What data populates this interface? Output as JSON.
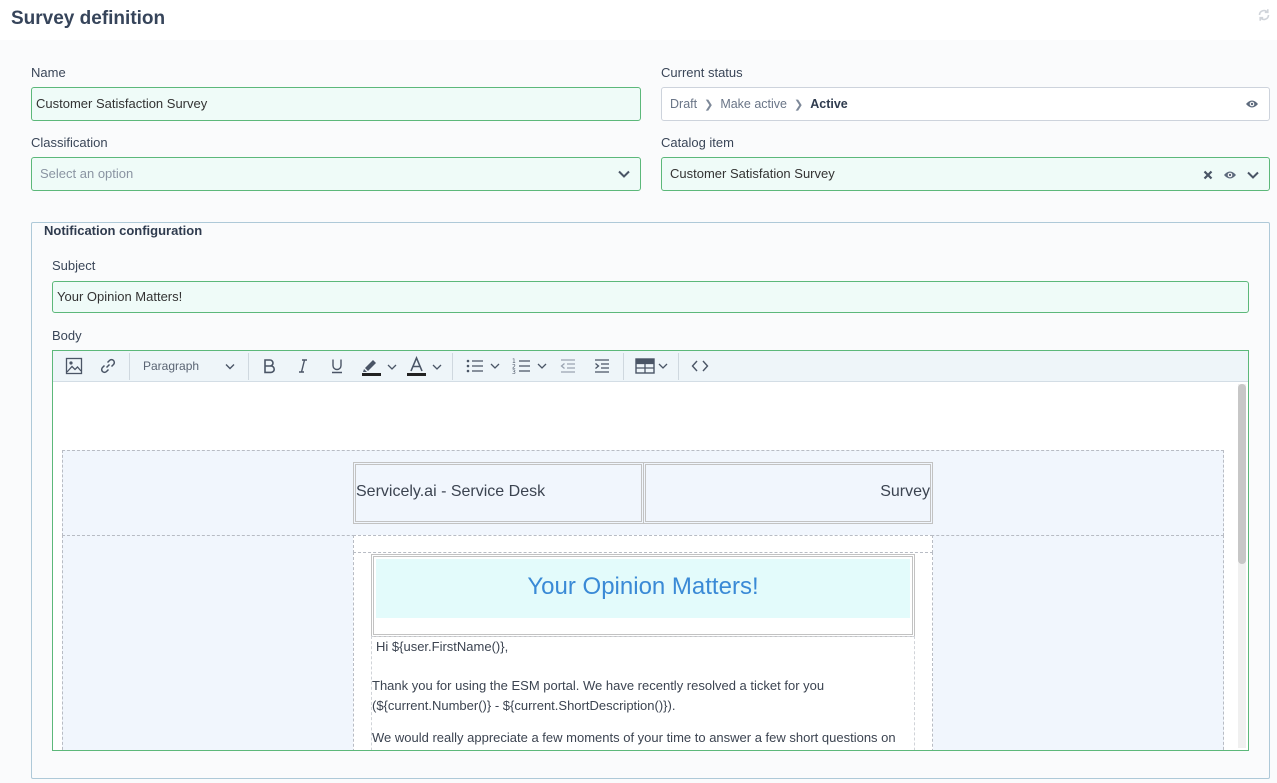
{
  "page": {
    "title": "Survey definition"
  },
  "form": {
    "name": {
      "label": "Name",
      "value": "Customer Satisfaction Survey"
    },
    "status": {
      "label": "Current status",
      "steps": [
        "Draft",
        "Make active",
        "Active"
      ]
    },
    "classification": {
      "label": "Classification",
      "placeholder": "Select an option"
    },
    "catalog": {
      "label": "Catalog item",
      "value": "Customer Satisfation Survey"
    }
  },
  "notification": {
    "legend": "Notification configuration",
    "subject": {
      "label": "Subject",
      "value": "Your Opinion Matters!"
    },
    "body": {
      "label": "Body"
    }
  },
  "toolbar": {
    "block_format": "Paragraph"
  },
  "email": {
    "brand": "Servicely.ai - Service Desk",
    "tag": "Survey",
    "heading": "Your Opinion Matters!",
    "greeting": "Hi ${user.FirstName()},",
    "para1_line1": "Thank you for using the ESM portal. We have recently resolved a ticket for you",
    "para1_line2": "(${current.Number()} - ${current.ShortDescription()}).",
    "para2_line1": "We would really appreciate a few moments of your time to answer a few short questions on"
  },
  "colors": {
    "field_border": "#5cb87a",
    "field_bg": "#effbf8",
    "heading_blue": "#3a8ad6",
    "heading_bg": "#e3fbfb"
  }
}
